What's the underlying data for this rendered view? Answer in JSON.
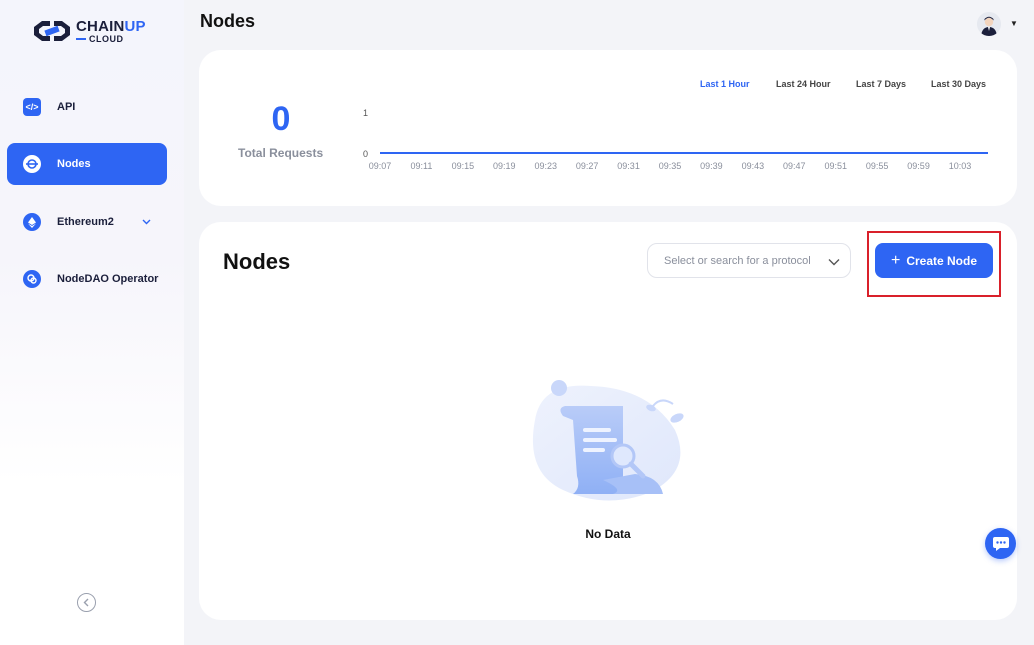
{
  "brand": {
    "name_main": "CHAIN",
    "name_accent": "UP",
    "name_sub": "CLOUD",
    "accent_color": "#2e65f3"
  },
  "header": {
    "title": "Nodes"
  },
  "sidebar": {
    "items": [
      {
        "label": "API",
        "icon": "code-icon",
        "active": false
      },
      {
        "label": "Nodes",
        "icon": "nodes-icon",
        "active": true
      },
      {
        "label": "Ethereum2",
        "icon": "ethereum-icon",
        "active": false,
        "expandable": true
      },
      {
        "label": "NodeDAO Operator",
        "icon": "nodedao-icon",
        "active": false
      }
    ],
    "collapse_icon": "chevron-left-icon"
  },
  "stats": {
    "total_value": "0",
    "total_label": "Total Requests",
    "ranges": [
      "Last 1 Hour",
      "Last 24 Hour",
      "Last 7 Days",
      "Last 30 Days"
    ],
    "active_range": "Last 1 Hour"
  },
  "chart_data": {
    "type": "line",
    "x": [
      "09:07",
      "09:11",
      "09:15",
      "09:19",
      "09:23",
      "09:27",
      "09:31",
      "09:35",
      "09:39",
      "09:43",
      "09:47",
      "09:51",
      "09:55",
      "09:59",
      "10:03"
    ],
    "series": [
      {
        "values": [
          0,
          0,
          0,
          0,
          0,
          0,
          0,
          0,
          0,
          0,
          0,
          0,
          0,
          0,
          0
        ]
      }
    ],
    "yticks": [
      "1",
      "0"
    ],
    "ylim": [
      0,
      1
    ],
    "grid": false,
    "color": "#2e65f3"
  },
  "nodes": {
    "title": "Nodes",
    "protocol_placeholder": "Select or search for a protocol",
    "create_label": "Create Node",
    "empty_text": "No Data"
  }
}
